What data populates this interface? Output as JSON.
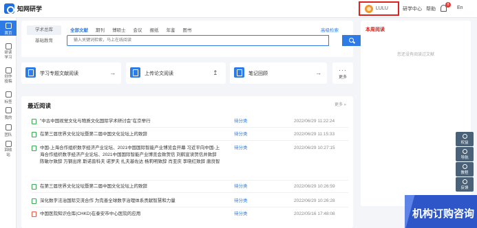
{
  "app": {
    "name": "知网研学"
  },
  "header": {
    "user_name": "LULU",
    "links": [
      "研学中心",
      "帮助",
      "En"
    ],
    "notification_count": "8"
  },
  "nav": {
    "items": [
      "首页",
      "研读学习",
      "创作投稿",
      "标签",
      "我的",
      "团队",
      "回收站"
    ]
  },
  "search": {
    "scopes": [
      "学术总库",
      "基础教育"
    ],
    "tabs": [
      "全部文献",
      "期刊",
      "博硕士",
      "会议",
      "报纸",
      "年鉴",
      "图书"
    ],
    "advanced": "高级检索",
    "placeholder": "输入关键词检索，马上在线阅读"
  },
  "quick": [
    {
      "label": "学习专题文献阅读",
      "arrow": "→"
    },
    {
      "label": "上传论文阅读",
      "arrow": "↥"
    },
    {
      "label": "笔记回顾",
      "arrow": "→"
    }
  ],
  "more": {
    "dots": "···",
    "label": "更多"
  },
  "recent": {
    "title": "最近阅读",
    "more": "更多 »",
    "rows": [
      {
        "title": "\"中古中国视觉文化与物质文化国际学术研讨会\"在京举行",
        "category": "待分类",
        "date": "2022/06/29 11:22:24",
        "icon": "doc"
      },
      {
        "title": "在第三届世界文化论坛暨第二届中国文化论坛上的致辞",
        "category": "待分类",
        "date": "2022/06/29 11:15:33",
        "icon": "doc"
      },
      {
        "title": "中国-上海合作组织数字经济产业论坛、2021中国国际智能产业博览会开幕 习近平向中国-上海合作组织数字经济产业论坛、2021中国国际智能产业博览会致贺信 刘鹤宣读贺信并致辞 陈敏尔致辞 万钢出席 斯诺普科夫 诺罗夫 扎夫基佐达 杨莉明致辞 肖亚庆 李晓红致辞 唐良智",
        "category": "待分类",
        "date": "2022/06/29 10:27:15",
        "icon": "doc"
      },
      {
        "title": "在第三届世界文化论坛暨第二届中国文化论坛上的致辞",
        "category": "待分类",
        "date": "2022/06/29 10:26:59",
        "icon": "doc"
      },
      {
        "title": "深化数字法治国际交流合作 为完善全球数字治理体系贡献智慧和力量",
        "category": "待分类",
        "date": "2022/06/29 10:26:28",
        "icon": "doc"
      },
      {
        "title": "中国医院知识仓库(CHKD)在泰安市中心医院的应用",
        "category": "待分类",
        "date": "2022/05/16 17:48:08",
        "icon": "pdf"
      }
    ]
  },
  "weekly": {
    "title": "本周阅读",
    "empty": "您还没有阅读过文献"
  },
  "float_tools": [
    "权益",
    "导航",
    "教程",
    "反馈"
  ],
  "banner": {
    "text": "机构订购咨询"
  },
  "colors": {
    "accent": "#2f7be5",
    "highlight": "#e0201a",
    "category": "#2f7be5"
  }
}
